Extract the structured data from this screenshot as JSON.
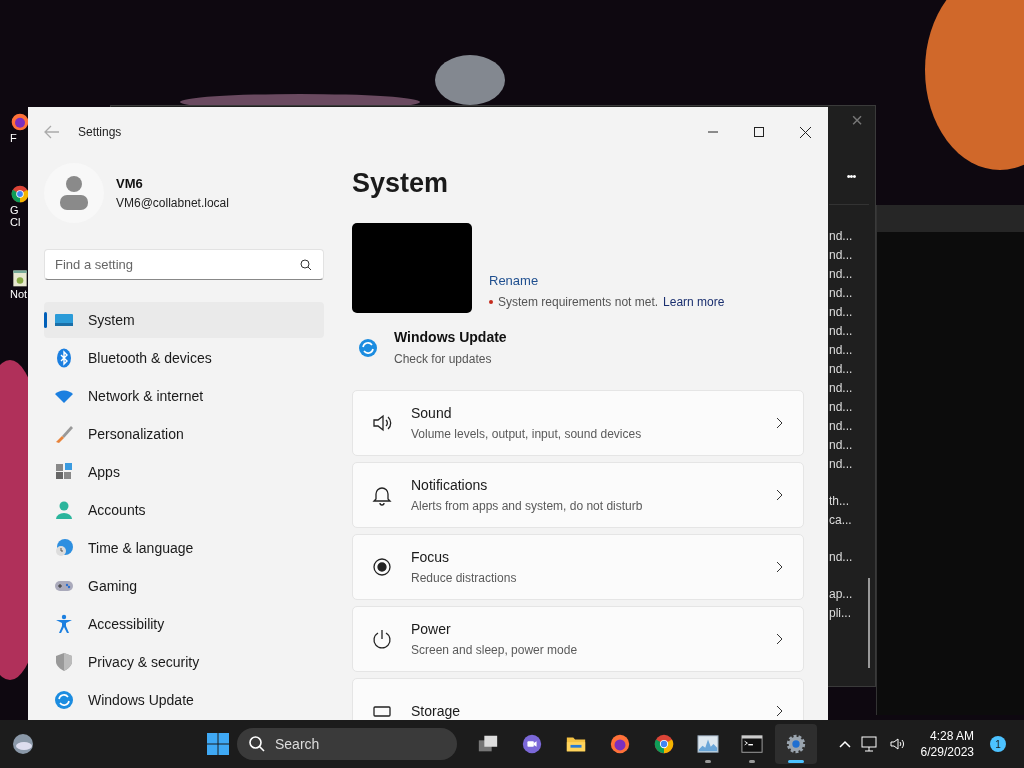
{
  "desktop_icons": [
    {
      "label": "F",
      "kind": "firefox"
    },
    {
      "label": "G Cl",
      "kind": "chrome"
    },
    {
      "label": "Not",
      "kind": "notepad"
    }
  ],
  "background_window": {
    "more": "•••",
    "close": "×",
    "row_groups": [
      [
        "nd...",
        "nd...",
        "nd...",
        "nd...",
        "nd...",
        "nd...",
        "nd...",
        "nd...",
        "nd...",
        "nd...",
        "nd...",
        "nd...",
        "nd..."
      ],
      [
        "th...",
        "ca..."
      ],
      [
        "nd..."
      ],
      [
        "ap...",
        "pli..."
      ]
    ]
  },
  "settings": {
    "title": "Settings",
    "user": {
      "name": "VM6",
      "email": "VM6@collabnet.local"
    },
    "search": {
      "placeholder": "Find a setting"
    },
    "nav": [
      {
        "label": "System",
        "kind": "system",
        "selected": true
      },
      {
        "label": "Bluetooth & devices",
        "kind": "bluetooth",
        "selected": false
      },
      {
        "label": "Network & internet",
        "kind": "network",
        "selected": false
      },
      {
        "label": "Personalization",
        "kind": "brush",
        "selected": false
      },
      {
        "label": "Apps",
        "kind": "apps",
        "selected": false
      },
      {
        "label": "Accounts",
        "kind": "accounts",
        "selected": false
      },
      {
        "label": "Time & language",
        "kind": "time",
        "selected": false
      },
      {
        "label": "Gaming",
        "kind": "gaming",
        "selected": false
      },
      {
        "label": "Accessibility",
        "kind": "accessibility",
        "selected": false
      },
      {
        "label": "Privacy & security",
        "kind": "privacy",
        "selected": false
      },
      {
        "label": "Windows Update",
        "kind": "update",
        "selected": false
      }
    ],
    "page_title": "System",
    "rename": "Rename",
    "requirement": "System requirements not met.",
    "learn_more": "Learn more",
    "update": {
      "title": "Windows Update",
      "subtitle": "Check for updates"
    },
    "cards": [
      {
        "title": "Sound",
        "subtitle": "Volume levels, output, input, sound devices",
        "kind": "sound"
      },
      {
        "title": "Notifications",
        "subtitle": "Alerts from apps and system, do not disturb",
        "kind": "bell"
      },
      {
        "title": "Focus",
        "subtitle": "Reduce distractions",
        "kind": "focus"
      },
      {
        "title": "Power",
        "subtitle": "Screen and sleep, power mode",
        "kind": "power"
      },
      {
        "title": "Storage",
        "kind": "storage"
      }
    ]
  },
  "taskbar": {
    "search": "Search",
    "apps": [
      {
        "kind": "taskview",
        "running": false,
        "active": false
      },
      {
        "kind": "chat",
        "running": false,
        "active": false
      },
      {
        "kind": "explorer",
        "running": false,
        "active": false
      },
      {
        "kind": "firefox",
        "running": false,
        "active": false
      },
      {
        "kind": "chrome",
        "running": false,
        "active": false
      },
      {
        "kind": "monitor",
        "running": true,
        "active": false
      },
      {
        "kind": "terminal",
        "running": true,
        "active": false
      },
      {
        "kind": "settings",
        "running": true,
        "active": true
      }
    ],
    "time": "4:28 AM",
    "date": "6/29/2023",
    "notifications": "1"
  }
}
